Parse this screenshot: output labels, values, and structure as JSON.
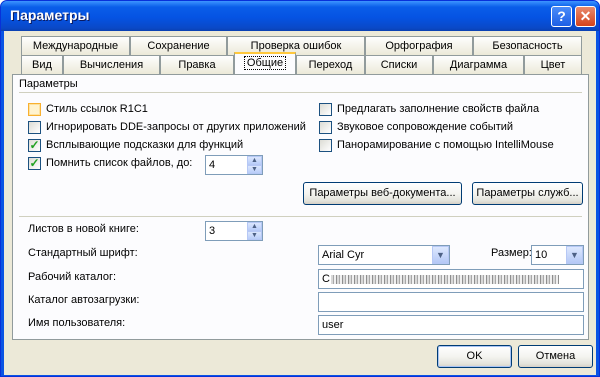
{
  "window": {
    "title": "Параметры"
  },
  "titlebar": {
    "help": "?",
    "close": "✕"
  },
  "tabs_back": [
    "Международные",
    "Сохранение",
    "Проверка ошибок",
    "Орфография",
    "Безопасность"
  ],
  "tabs_front": [
    "Вид",
    "Вычисления",
    "Правка",
    "Общие",
    "Переход",
    "Списки",
    "Диаграмма",
    "Цвет"
  ],
  "active_tab": "Общие",
  "group": {
    "title": "Параметры"
  },
  "checkboxes": {
    "r1c1": {
      "label": "Стиль ссылок R1C1",
      "checked": false
    },
    "ignore_dde": {
      "label": "Игнорировать DDE-запросы от других приложений",
      "checked": false
    },
    "tooltips": {
      "label": "Всплывающие подсказки для функций",
      "checked": true
    },
    "recent_files": {
      "label": "Помнить список файлов, до:",
      "checked": true
    },
    "autofill_props": {
      "label": "Предлагать заполнение свойств файла",
      "checked": false
    },
    "sound": {
      "label": "Звуковое сопровождение событий",
      "checked": false
    },
    "intellimouse": {
      "label": "Панорамирование с помощью IntelliMouse",
      "checked": false
    }
  },
  "recent_count": "4",
  "buttons": {
    "web_options": "Параметры веб-документа...",
    "service_options": "Параметры служб...",
    "ok": "OK",
    "cancel": "Отмена"
  },
  "fields": {
    "sheets_label": "Листов в новой книге:",
    "sheets_value": "3",
    "font_label": "Стандартный шрифт:",
    "font_value": "Arial Cyr",
    "size_label": "Размер:",
    "size_value": "10",
    "workdir_label": "Рабочий каталог:",
    "workdir_value": "C",
    "autoload_label": "Каталог автозагрузки:",
    "autoload_value": "",
    "username_label": "Имя пользователя:",
    "username_value": "user"
  }
}
